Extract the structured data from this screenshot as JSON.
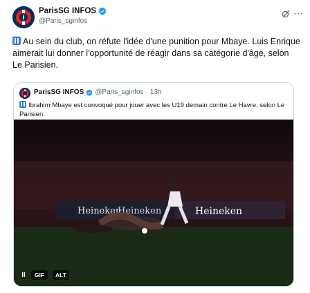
{
  "tweet": {
    "author_name": "ParisSG INFOS",
    "author_handle": "@Paris_sginfos",
    "icons": [
      "psg-avatar",
      "verified-badge-icon",
      "grok-icon",
      "more-icon"
    ],
    "text": "Au sein du club, on réfute l'idée d'une punition pour Mbaye. Luis Enrique aimerait lui donner l'opportunité de réagir dans sa catégorie d'âge, selon Le Parisien."
  },
  "quote": {
    "author_name": "ParisSG INFOS",
    "author_handle": "@Paris_sginfos",
    "separator": "·",
    "time": "13h",
    "text": "Ibrahim Mbaye est convoqué pour jouer avec les U19 demain contre Le Havre, selon Le Parisien.",
    "media": {
      "ad_texts": [
        "Heineken",
        "Heineken",
        "Heineken"
      ],
      "pause_label": "II",
      "gif_label": "GIF",
      "alt_label": "ALT"
    }
  },
  "colors": {
    "text": "#0f1419",
    "secondary": "#536471",
    "border": "#cfd9de",
    "verified": "#1d9bf0",
    "emoji": "#3a7bd5"
  }
}
